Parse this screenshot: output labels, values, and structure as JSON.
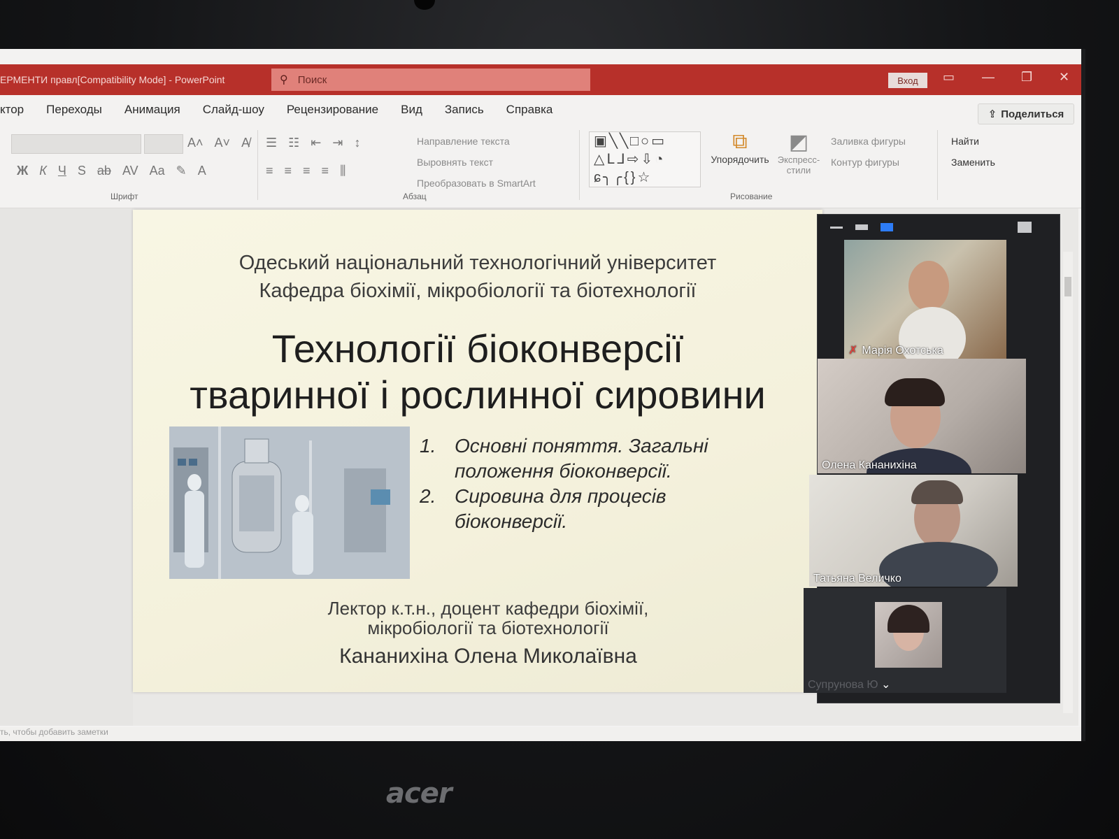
{
  "window": {
    "title": "ЕРМЕНТИ правл[Compatibility Mode]  -  PowerPoint",
    "search_placeholder": "Поиск",
    "login_label": "Вход",
    "share_label": "Поделиться"
  },
  "menu": {
    "items": [
      "ктор",
      "Переходы",
      "Анимация",
      "Слайд-шоу",
      "Рецензирование",
      "Вид",
      "Запись",
      "Справка"
    ]
  },
  "ribbon": {
    "font_group": "Шрифт",
    "paragraph_group": "Абзац",
    "drawing_group": "Рисование",
    "text_direction": "Направление текста",
    "align_text": "Выровнять текст",
    "convert_smartart": "Преобразовать в SmartArt",
    "arrange": "Упорядочить",
    "quick_styles": "Экспресс-стили",
    "shape_fill": "Заливка фигуры",
    "shape_outline": "Контур фигуры",
    "find": "Найти",
    "replace": "Заменить"
  },
  "slide": {
    "university_line1": "Одеський національний технологічний університет",
    "university_line2": "Кафедра біохімії, мікробіології та біотехнології",
    "title_line1": "Технології біоконверсії",
    "title_line2": "тваринної і рослинної сировини",
    "list": [
      {
        "num": "1.",
        "text": "Основні поняття. Загальні положення біоконверсії."
      },
      {
        "num": "2.",
        "text": "Сировина для процесів біоконверсії."
      }
    ],
    "lector_line1": "Лектор к.т.н., доцент кафедри біохімії,",
    "lector_line2": "мікробіології та біотехнології",
    "lector_name": "Кананихіна Олена Миколаївна"
  },
  "notes_hint": "ть, чтобы добавить заметки",
  "participants": [
    {
      "name": "Марія Охотська",
      "muted": true
    },
    {
      "name": "Олена Кананихіна",
      "muted": false
    },
    {
      "name": "Татьяна Величко",
      "muted": false
    },
    {
      "name": "Супрунова Ю",
      "muted": false
    }
  ],
  "device_brand": "acer"
}
